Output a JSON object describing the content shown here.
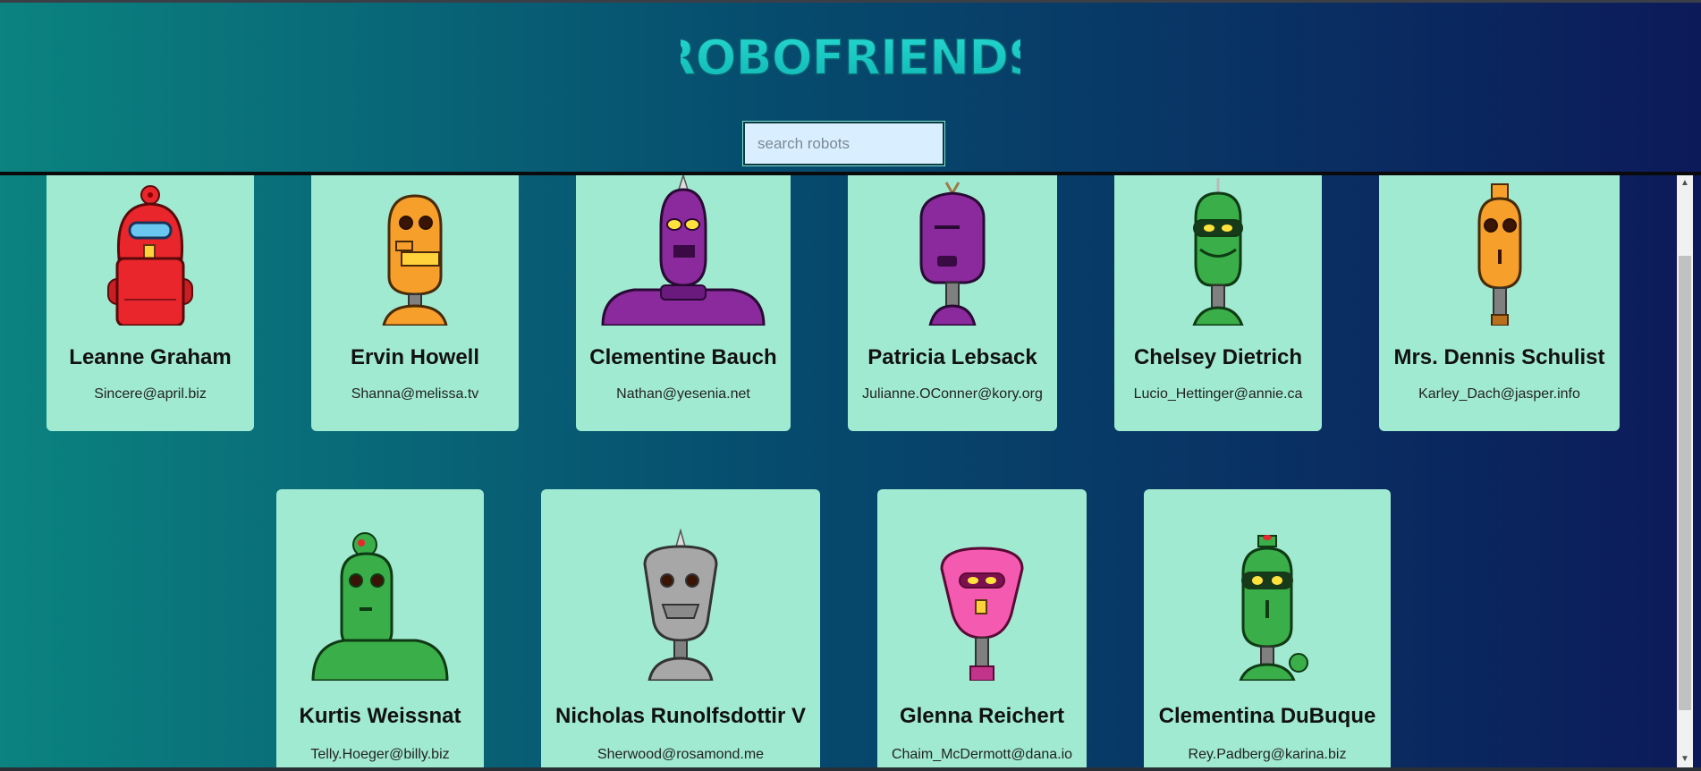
{
  "app": {
    "title": "ROBOFRIENDS"
  },
  "search": {
    "placeholder": "search robots",
    "value": ""
  },
  "robots": [
    {
      "name": "Leanne Graham",
      "email": "Sincere@april.biz",
      "color": "#e8262c"
    },
    {
      "name": "Ervin Howell",
      "email": "Shanna@melissa.tv",
      "color": "#f6a02b"
    },
    {
      "name": "Clementine Bauch",
      "email": "Nathan@yesenia.net",
      "color": "#8a2a9c"
    },
    {
      "name": "Patricia Lebsack",
      "email": "Julianne.OConner@kory.org",
      "color": "#8a2a9c"
    },
    {
      "name": "Chelsey Dietrich",
      "email": "Lucio_Hettinger@annie.ca",
      "color": "#3aae48"
    },
    {
      "name": "Mrs. Dennis Schulist",
      "email": "Karley_Dach@jasper.info",
      "color": "#f6a02b"
    },
    {
      "name": "Kurtis Weissnat",
      "email": "Telly.Hoeger@billy.biz",
      "color": "#3aae48"
    },
    {
      "name": "Nicholas Runolfsdottir V",
      "email": "Sherwood@rosamond.me",
      "color": "#a7a7a7"
    },
    {
      "name": "Glenna Reichert",
      "email": "Chaim_McDermott@dana.io",
      "color": "#f45ab0"
    },
    {
      "name": "Clementina DuBuque",
      "email": "Rey.Padberg@karina.biz",
      "color": "#3aae48"
    }
  ]
}
